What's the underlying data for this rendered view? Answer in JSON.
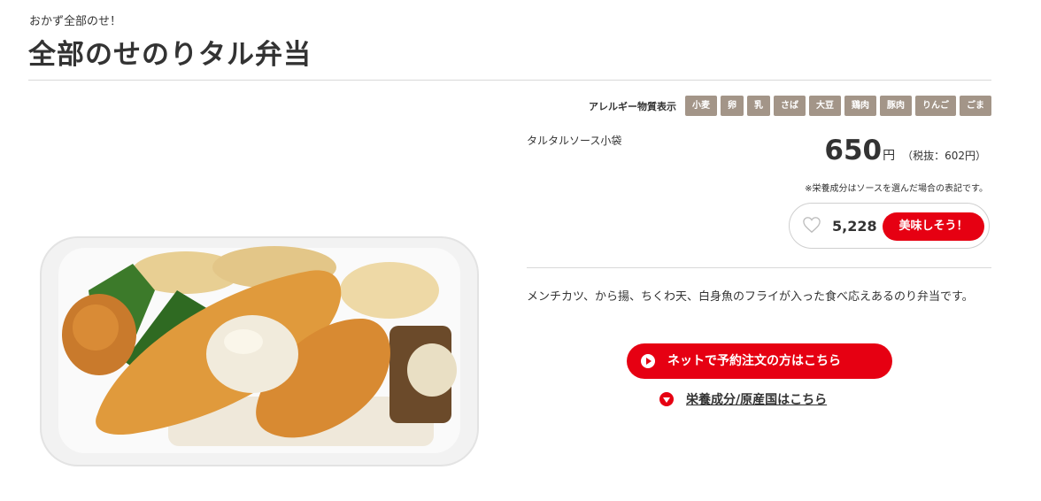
{
  "header": {
    "category": "おかず全部のせ！",
    "title": "全部のせのりタル弁当"
  },
  "allergy": {
    "label": "アレルギー物質表示",
    "items": [
      "小麦",
      "卵",
      "乳",
      "さば",
      "大豆",
      "鶏肉",
      "豚肉",
      "りんご",
      "ごま"
    ],
    "chip_color": "#a39588"
  },
  "product": {
    "sauce": "タルタルソース小袋",
    "price": "650",
    "price_unit": "円",
    "price_tax": "（税抜：602円）",
    "note": "※栄養成分はソースを選んだ場合の表記です。",
    "description": "メンチカツ、から揚、ちくわ天、白身魚のフライが入った食べ応えあるのり弁当です。"
  },
  "like": {
    "icon": "heart-outline-icon",
    "count": "5,228",
    "button_label": "美味しそう！"
  },
  "actions": {
    "order_label": "ネットで予約注文の方はこちら",
    "order_icon": "play-circle-icon",
    "nutrition_label": "栄養成分/原産国はこちら",
    "nutrition_icon": "chevron-down-circle-icon"
  },
  "colors": {
    "accent": "#e60012",
    "text": "#333333",
    "divider": "#d9d9d9"
  }
}
